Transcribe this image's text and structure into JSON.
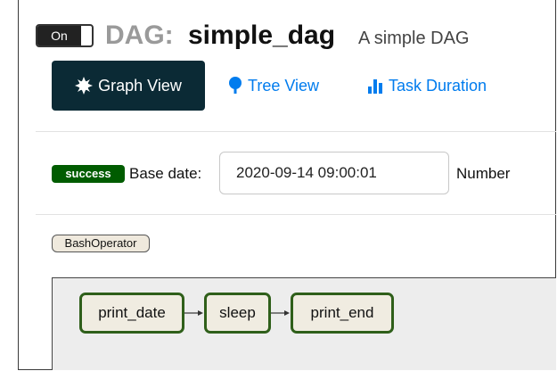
{
  "header": {
    "toggle_label": "On",
    "dag_label": "DAG:",
    "dag_name": "simple_dag",
    "dag_description": "A simple DAG"
  },
  "tabs": [
    {
      "label": "Graph View",
      "icon": "asterisk-icon",
      "active": true
    },
    {
      "label": "Tree View",
      "icon": "tree-icon",
      "active": false
    },
    {
      "label": "Task Duration",
      "icon": "bar-chart-icon",
      "active": false
    }
  ],
  "controls": {
    "status_badge": "success",
    "base_date_label": "Base date:",
    "base_date_value": "2020-09-14 09:00:01",
    "number_label": "Number"
  },
  "legend": {
    "operator_label": "BashOperator"
  },
  "graph": {
    "nodes": [
      {
        "label": "print_date"
      },
      {
        "label": "sleep"
      },
      {
        "label": "print_end"
      }
    ]
  },
  "colors": {
    "active_tab_bg": "#0b2a35",
    "link": "#017cee",
    "success_badge": "#005c00",
    "node_border": "#2f5f1a",
    "node_fill": "#f0ece1",
    "operator_fill": "#efe9dd"
  }
}
